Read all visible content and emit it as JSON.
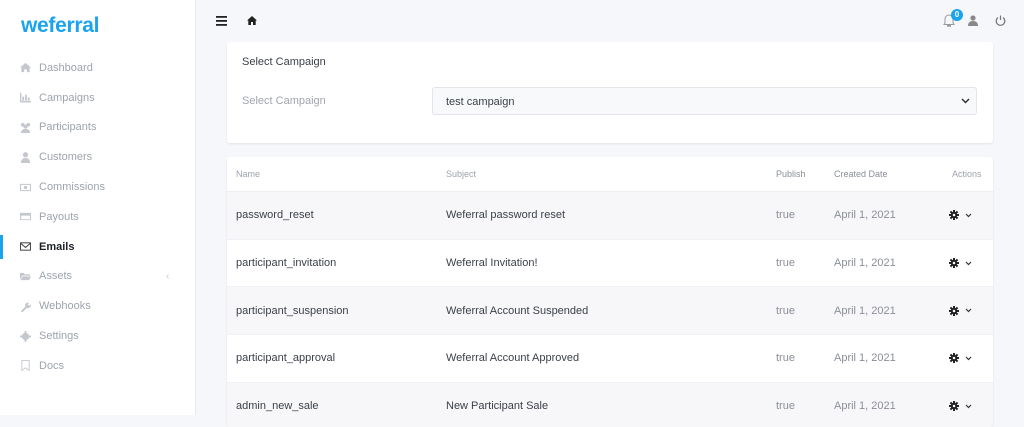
{
  "app": {
    "logo": "weferral"
  },
  "sidebar": {
    "items": [
      {
        "label": "Dashboard",
        "icon": "home-icon"
      },
      {
        "label": "Campaigns",
        "icon": "chart-icon"
      },
      {
        "label": "Participants",
        "icon": "users-icon"
      },
      {
        "label": "Customers",
        "icon": "user-icon"
      },
      {
        "label": "Commissions",
        "icon": "money-icon"
      },
      {
        "label": "Payouts",
        "icon": "credit-card-icon"
      },
      {
        "label": "Emails",
        "icon": "envelope-icon",
        "active": true
      },
      {
        "label": "Assets",
        "icon": "folder-icon",
        "caret": "‹"
      },
      {
        "label": "Webhooks",
        "icon": "wrench-icon"
      },
      {
        "label": "Settings",
        "icon": "gear-icon"
      },
      {
        "label": "Docs",
        "icon": "bookmark-icon"
      }
    ]
  },
  "topbar": {
    "notification_count": "0"
  },
  "campaign": {
    "title": "Select Campaign",
    "label": "Select Campaign",
    "value": "test campaign"
  },
  "table": {
    "headers": {
      "name": "Name",
      "subject": "Subject",
      "publish": "Publish",
      "created": "Created Date",
      "actions": "Actions"
    },
    "rows": [
      {
        "name": "password_reset",
        "subject": "Weferral password reset",
        "publish": "true",
        "created": "April 1, 2021"
      },
      {
        "name": "participant_invitation",
        "subject": "Weferral Invitation!",
        "publish": "true",
        "created": "April 1, 2021"
      },
      {
        "name": "participant_suspension",
        "subject": "Weferral Account Suspended",
        "publish": "true",
        "created": "April 1, 2021"
      },
      {
        "name": "participant_approval",
        "subject": "Weferral Account Approved",
        "publish": "true",
        "created": "April 1, 2021"
      },
      {
        "name": "admin_new_sale",
        "subject": "New Participant Sale",
        "publish": "true",
        "created": "April 1, 2021"
      }
    ]
  }
}
